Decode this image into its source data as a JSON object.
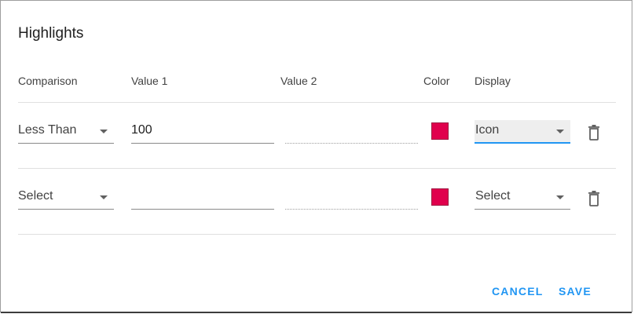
{
  "dialog": {
    "title": "Highlights"
  },
  "columns": {
    "comparison": "Comparison",
    "value1": "Value 1",
    "value2": "Value 2",
    "color": "Color",
    "display": "Display"
  },
  "rows": [
    {
      "comparison": "Less Than",
      "value1": "100",
      "value2": "",
      "color": "#e0004d",
      "display": "Icon"
    },
    {
      "comparison": "Select",
      "value1": "",
      "value2": "",
      "color": "#e0004d",
      "display": "Select"
    }
  ],
  "icons": {
    "dropdown": "chevron-down-icon",
    "delete": "trash-icon"
  },
  "actions": {
    "cancel": "CANCEL",
    "save": "SAVE"
  },
  "colors": {
    "accent": "#2196f3",
    "swatch": "#e0004d"
  }
}
